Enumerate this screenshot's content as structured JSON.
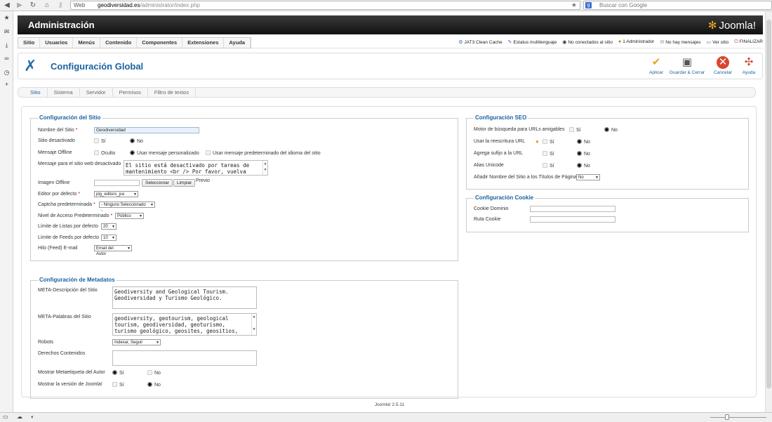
{
  "browser": {
    "web_label": "Web",
    "url_host": "geodiversidad.es",
    "url_path": "/administrator/index.php",
    "search_placeholder": "Buscar con Google"
  },
  "header": {
    "title": "Administración",
    "logo_text": "Joomla!"
  },
  "menu": [
    "Sitio",
    "Usuarios",
    "Menús",
    "Contenido",
    "Componentes",
    "Extensiones",
    "Ayuda"
  ],
  "status": {
    "cache": "JAT3 Clean Cache",
    "lang": "Estatus multilenguaje",
    "connected": "No conectados al sitio",
    "admin": "1 Administrador",
    "messages": "No hay mensajes",
    "view_site": "Ver sitio",
    "logout": "FINALIZAR"
  },
  "toolbar": {
    "title": "Configuración Global",
    "apply": "Aplicar",
    "save_close": "Guardar & Cerrar",
    "cancel": "Cancelar",
    "help": "Ayuda"
  },
  "tabs": [
    "Sitio",
    "Sistema",
    "Servidor",
    "Permisos",
    "Filtro de textos"
  ],
  "site": {
    "title": "Configuración del Sitio",
    "site_name_label": "Nombre del Sitio",
    "site_name_value": "Geodiversidad",
    "offline_label": "Sitio desactivado",
    "yes": "Sí",
    "no": "No",
    "offline_msg_label": "Mensaje Offline",
    "hidden": "Oculto",
    "custom_msg": "Usar mensaje personalizado",
    "default_msg": "Usar mensaje predeterminado del idioma del sitio",
    "offline_text_label": "Mensaje para el sitio web desactivado",
    "offline_text": "El sitio está desactivado por tareas de\nmantenimiento <br /> Por favor, vuelva",
    "image_label": "Imagen Offline",
    "select_btn": "Seleccionar",
    "clear_btn": "Limpiar",
    "preview": "Previo",
    "editor_label": "Editor por defecto",
    "editor_value": "plg_editors_jce",
    "captcha_label": "Captcha predeterminada",
    "captcha_value": "- Ninguno Seleccionado -",
    "access_label": "Nivel de Acceso Predeterminado",
    "access_value": "Público",
    "list_label": "Límite de Listas por defecto",
    "list_value": "20",
    "feed_label": "Límite de Feeds por defecto",
    "feed_value": "10",
    "email_label": "Hilo (Feed) E-mail",
    "email_value": "Email del Autor"
  },
  "meta": {
    "title": "Configuración de Metadatos",
    "desc_label": "META-Descripción del Sitio",
    "desc_text": "Geodiversity and Geological Tourism.\nGeodiversidad y Turismo Geológico.",
    "keywords_label": "META-Palabras del Sitio",
    "keywords_text": "geodiversity, geotourism, geological\ntourism, geodiversidad, geoturismo,\nturismo geológico, geosites, geositios,",
    "robots_label": "Robots",
    "robots_value": "Indexar, Seguir",
    "rights_label": "Derechos Contenidos",
    "author_label": "Mostrar Metaetiqueta del Autor",
    "version_label": "Mostrar la versión de Joomla!"
  },
  "seo": {
    "title": "Configuración SEO",
    "sef_label": "Motor de búsqueda para URLs amigables",
    "rewrite_label": "Usar la reescritura URL",
    "suffix_label": "Agrega sufijo a la URL",
    "unicode_label": "Alias Unicode",
    "sitename_label": "Añadir Nombre del Sitio a los Títulos de Páginas",
    "sitename_value": "No"
  },
  "cookie": {
    "title": "Configuración Cookie",
    "domain_label": "Cookie Dominio",
    "path_label": "Ruta Cookie"
  },
  "footer": "Joomla! 2.5.11"
}
